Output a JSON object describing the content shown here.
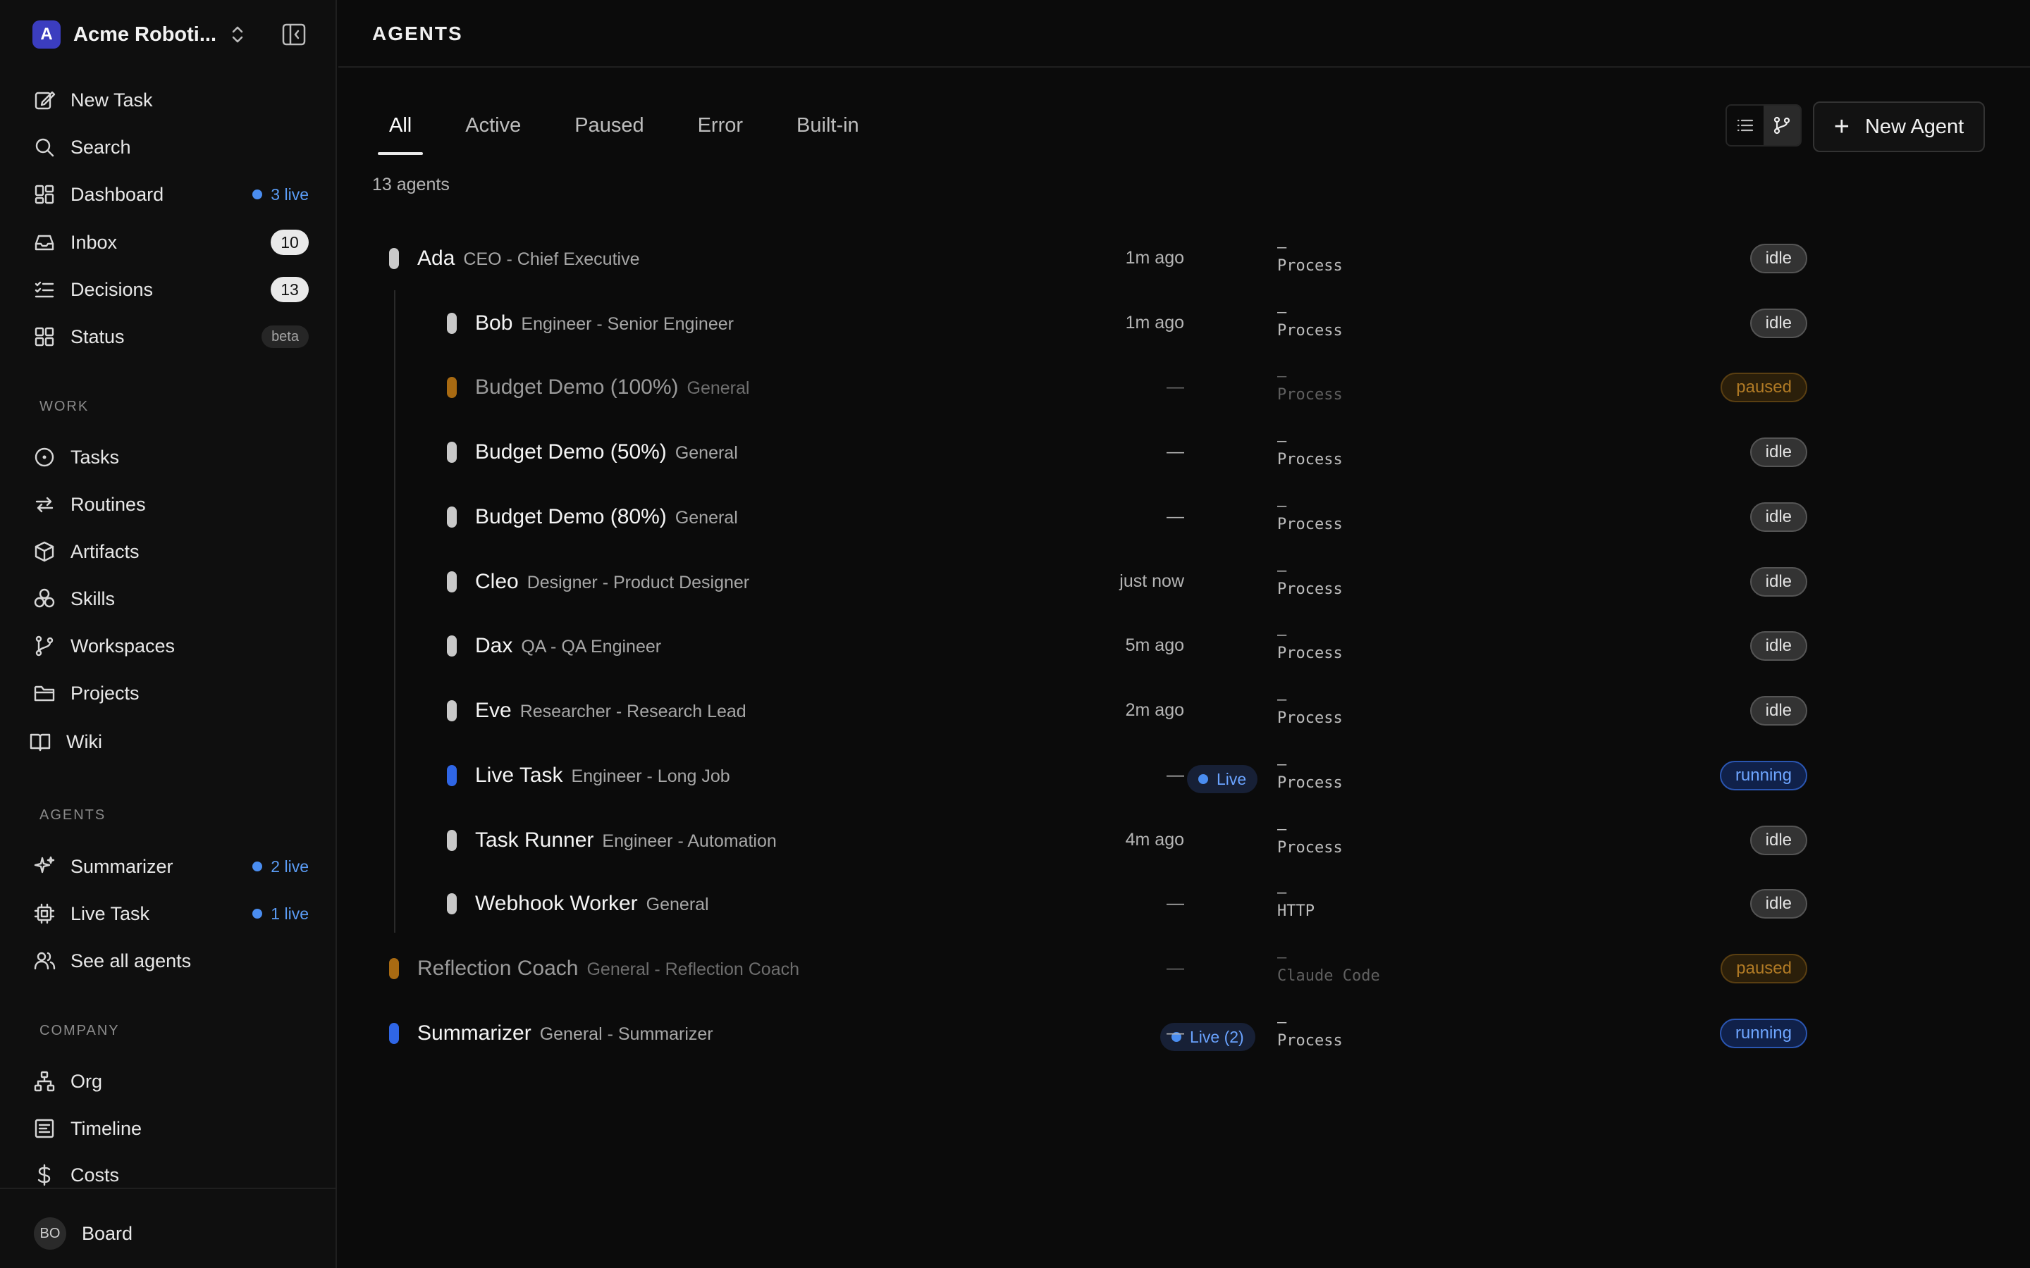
{
  "workspace": {
    "logo_letter": "A",
    "name": "Acme Roboti..."
  },
  "colors": {
    "accent_blue": "#4a8df0",
    "idle_bar": "#c9c9c9",
    "paused_bar": "#a86a12",
    "running_bar": "#2f66e6"
  },
  "sidebar": {
    "main_items": [
      {
        "icon": "edit-icon",
        "label": "New Task"
      },
      {
        "icon": "search-icon",
        "label": "Search"
      },
      {
        "icon": "dashboard-icon",
        "label": "Dashboard",
        "live": "3 live"
      },
      {
        "icon": "inbox-icon",
        "label": "Inbox",
        "count": "10"
      },
      {
        "icon": "checklist-icon",
        "label": "Decisions",
        "count": "13"
      },
      {
        "icon": "grid-icon",
        "label": "Status",
        "badge": "beta"
      }
    ],
    "work_label": "WORK",
    "work_items": [
      {
        "icon": "circle-dot-icon",
        "label": "Tasks"
      },
      {
        "icon": "repeat-icon",
        "label": "Routines"
      },
      {
        "icon": "box-icon",
        "label": "Artifacts"
      },
      {
        "icon": "skills-icon",
        "label": "Skills"
      },
      {
        "icon": "git-branch-icon",
        "label": "Workspaces"
      },
      {
        "icon": "folder-icon",
        "label": "Projects"
      },
      {
        "icon": "book-icon",
        "label": "Wiki"
      }
    ],
    "agents_label": "AGENTS",
    "agent_items": [
      {
        "icon": "sparkles-icon",
        "label": "Summarizer",
        "live": "2 live"
      },
      {
        "icon": "cpu-icon",
        "label": "Live Task",
        "live": "1 live"
      },
      {
        "icon": "users-icon",
        "label": "See all agents"
      }
    ],
    "company_label": "COMPANY",
    "company_items": [
      {
        "icon": "org-icon",
        "label": "Org"
      },
      {
        "icon": "timeline-icon",
        "label": "Timeline"
      },
      {
        "icon": "dollar-icon",
        "label": "Costs"
      }
    ],
    "board": {
      "initials": "BO",
      "label": "Board"
    }
  },
  "header": {
    "title": "AGENTS"
  },
  "tabs": [
    "All",
    "Active",
    "Paused",
    "Error",
    "Built-in"
  ],
  "active_tab": "All",
  "toolbar": {
    "new_agent_label": "New Agent"
  },
  "agent_count": "13 agents",
  "agents": [
    {
      "name": "Ada",
      "role": "CEO - Chief Executive",
      "adapter_dash": "–",
      "adapter": "Process",
      "time": "1m ago",
      "status": "idle",
      "depth": 0
    },
    {
      "name": "Bob",
      "role": "Engineer - Senior Engineer",
      "adapter_dash": "–",
      "adapter": "Process",
      "time": "1m ago",
      "status": "idle",
      "depth": 1
    },
    {
      "name": "Budget Demo (100%)",
      "role": "General",
      "adapter_dash": "–",
      "adapter": "Process",
      "time": "—",
      "status": "paused",
      "depth": 1
    },
    {
      "name": "Budget Demo (50%)",
      "role": "General",
      "adapter_dash": "–",
      "adapter": "Process",
      "time": "—",
      "status": "idle",
      "depth": 1
    },
    {
      "name": "Budget Demo (80%)",
      "role": "General",
      "adapter_dash": "–",
      "adapter": "Process",
      "time": "—",
      "status": "idle",
      "depth": 1
    },
    {
      "name": "Cleo",
      "role": "Designer - Product Designer",
      "adapter_dash": "–",
      "adapter": "Process",
      "time": "just now",
      "status": "idle",
      "depth": 1
    },
    {
      "name": "Dax",
      "role": "QA - QA Engineer",
      "adapter_dash": "–",
      "adapter": "Process",
      "time": "5m ago",
      "status": "idle",
      "depth": 1
    },
    {
      "name": "Eve",
      "role": "Researcher - Research Lead",
      "adapter_dash": "–",
      "adapter": "Process",
      "time": "2m ago",
      "status": "idle",
      "depth": 1
    },
    {
      "name": "Live Task",
      "role": "Engineer - Long Job",
      "live": "Live",
      "adapter_dash": "–",
      "adapter": "Process",
      "time": "—",
      "status": "running",
      "depth": 1
    },
    {
      "name": "Task Runner",
      "role": "Engineer - Automation",
      "adapter_dash": "–",
      "adapter": "Process",
      "time": "4m ago",
      "status": "idle",
      "depth": 1
    },
    {
      "name": "Webhook Worker",
      "role": "General",
      "adapter_dash": "–",
      "adapter": "HTTP",
      "time": "—",
      "status": "idle",
      "depth": 1
    },
    {
      "name": "Reflection Coach",
      "role": "General - Reflection Coach",
      "adapter_dash": "–",
      "adapter": "Claude Code",
      "time": "—",
      "status": "paused",
      "depth": 0
    },
    {
      "name": "Summarizer",
      "role": "General - Summarizer",
      "live": "Live (2)",
      "adapter_dash": "–",
      "adapter": "Process",
      "time": "—",
      "status": "running",
      "depth": 0
    }
  ]
}
